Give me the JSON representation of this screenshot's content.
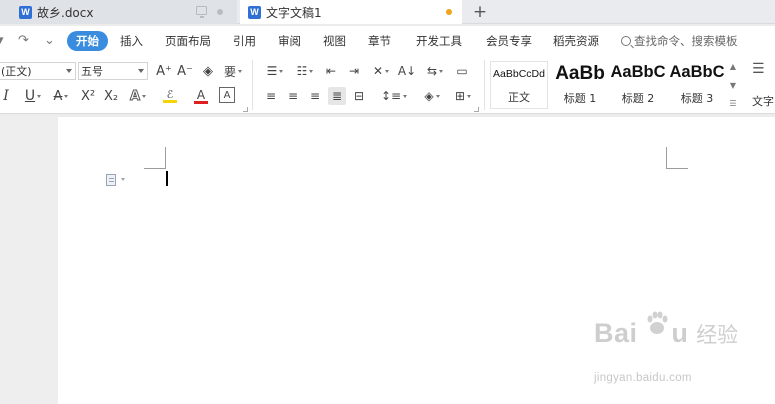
{
  "tabs": [
    {
      "title": "故乡.docx",
      "icon": "W",
      "active": false
    },
    {
      "title": "文字文稿1",
      "icon": "W",
      "active": true
    }
  ],
  "quick_access": {
    "redo_glyph": "↷",
    "more_glyph": "⇐"
  },
  "menu": {
    "items": [
      "开始",
      "插入",
      "页面布局",
      "引用",
      "审阅",
      "视图",
      "章节",
      "开发工具",
      "会员专享",
      "稻壳资源"
    ],
    "active": "开始",
    "search_placeholder": "查找命令、搜索模板"
  },
  "ribbon": {
    "font_name": "(正文)",
    "font_size": "五号",
    "format_glyphs": {
      "grow": "A⁺",
      "shrink": "A⁻",
      "clear": "◈",
      "phonetic": "要",
      "italic": "I",
      "underline": "U",
      "strike": "A",
      "superscript": "X²",
      "subscript": "X₂",
      "effects": "A",
      "highlight": "ℰ",
      "font_color": "A",
      "char_border": "A"
    },
    "styles": [
      {
        "sample": "AaBbCcDd",
        "name": "正文"
      },
      {
        "sample": "AaBb",
        "name": "标题 1"
      },
      {
        "sample": "AaBbC",
        "name": "标题 2"
      },
      {
        "sample": "AaBbC",
        "name": "标题 3"
      },
      {
        "sample": "",
        "name": "文字"
      }
    ]
  },
  "colors": {
    "accent": "#3a8dde",
    "word_icon": "#2f6fd6",
    "unsaved_dot": "#f0a41e",
    "highlight_bar": "#f5d40b",
    "font_color_bar": "#e02020"
  },
  "watermark": {
    "brand": "Bai",
    "brand_tail": "u",
    "brand_cn": "经验",
    "url": "jingyan.baidu.com"
  }
}
